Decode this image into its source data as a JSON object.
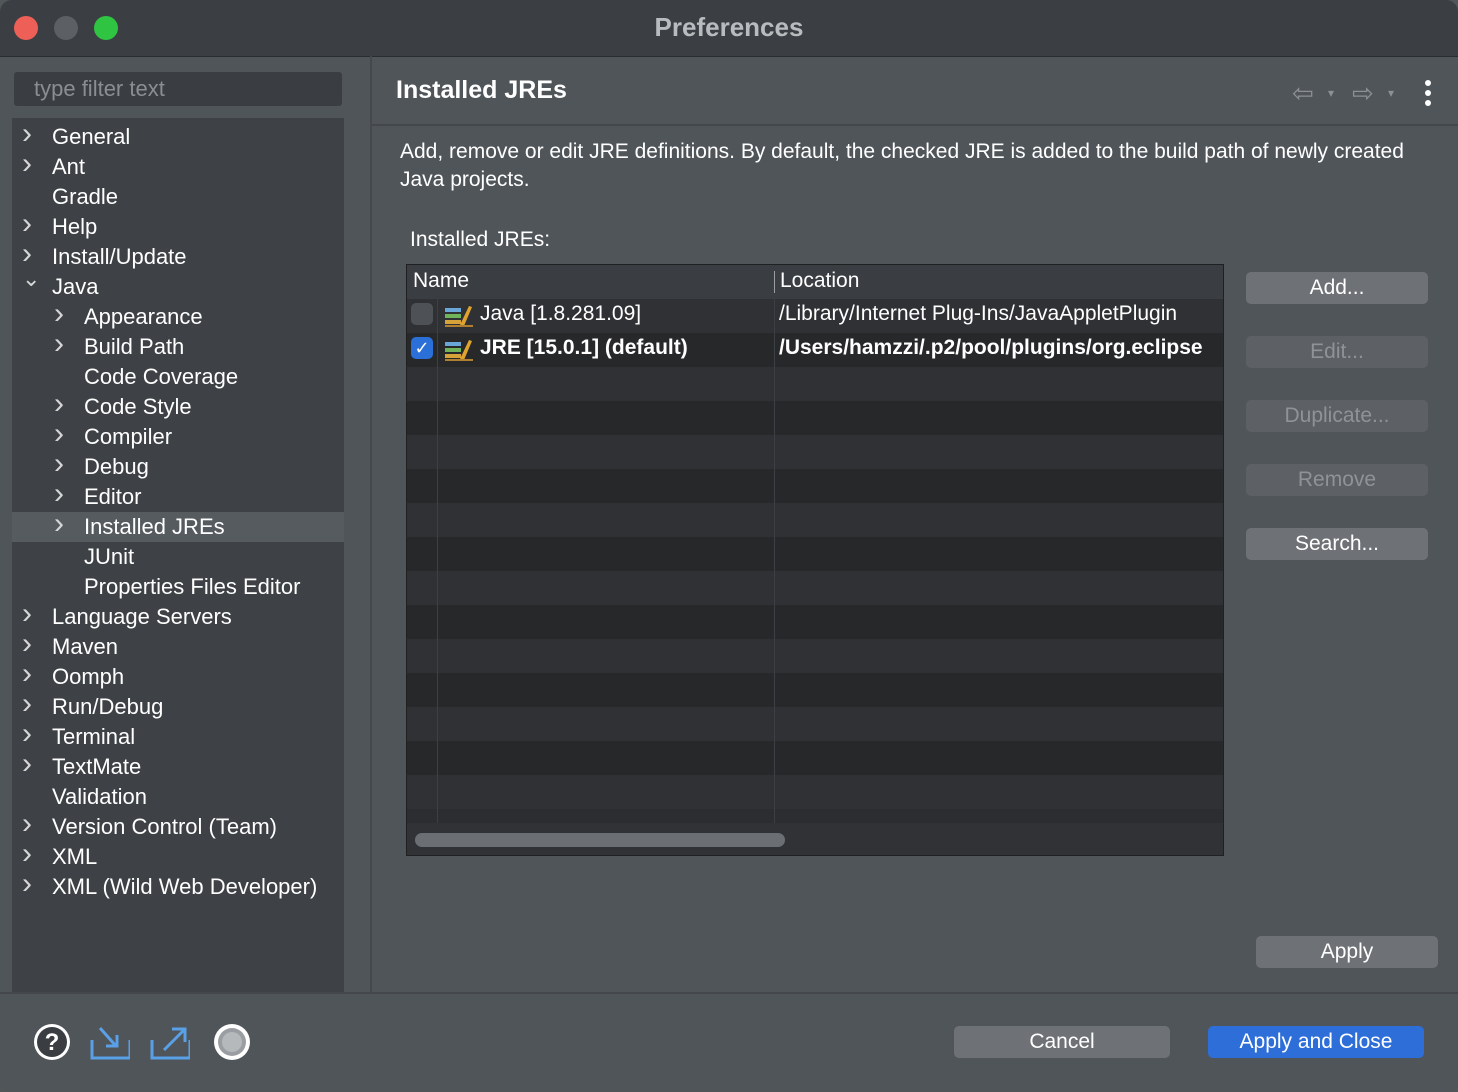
{
  "window": {
    "title": "Preferences"
  },
  "filter": {
    "placeholder": "type filter text"
  },
  "tree": [
    {
      "label": "General",
      "expandable": true,
      "level": 0
    },
    {
      "label": "Ant",
      "expandable": true,
      "level": 0
    },
    {
      "label": "Gradle",
      "expandable": false,
      "level": 0
    },
    {
      "label": "Help",
      "expandable": true,
      "level": 0
    },
    {
      "label": "Install/Update",
      "expandable": true,
      "level": 0
    },
    {
      "label": "Java",
      "expandable": true,
      "expanded": true,
      "level": 0
    },
    {
      "label": "Appearance",
      "expandable": true,
      "level": 1
    },
    {
      "label": "Build Path",
      "expandable": true,
      "level": 1
    },
    {
      "label": "Code Coverage",
      "expandable": false,
      "level": 1
    },
    {
      "label": "Code Style",
      "expandable": true,
      "level": 1
    },
    {
      "label": "Compiler",
      "expandable": true,
      "level": 1
    },
    {
      "label": "Debug",
      "expandable": true,
      "level": 1
    },
    {
      "label": "Editor",
      "expandable": true,
      "level": 1
    },
    {
      "label": "Installed JREs",
      "expandable": true,
      "level": 1,
      "selected": true
    },
    {
      "label": "JUnit",
      "expandable": false,
      "level": 1
    },
    {
      "label": "Properties Files Editor",
      "expandable": false,
      "level": 1
    },
    {
      "label": "Language Servers",
      "expandable": true,
      "level": 0
    },
    {
      "label": "Maven",
      "expandable": true,
      "level": 0
    },
    {
      "label": "Oomph",
      "expandable": true,
      "level": 0
    },
    {
      "label": "Run/Debug",
      "expandable": true,
      "level": 0
    },
    {
      "label": "Terminal",
      "expandable": true,
      "level": 0
    },
    {
      "label": "TextMate",
      "expandable": true,
      "level": 0
    },
    {
      "label": "Validation",
      "expandable": false,
      "level": 0
    },
    {
      "label": "Version Control (Team)",
      "expandable": true,
      "level": 0
    },
    {
      "label": "XML",
      "expandable": true,
      "level": 0
    },
    {
      "label": "XML (Wild Web Developer)",
      "expandable": true,
      "level": 0
    }
  ],
  "page": {
    "title": "Installed JREs",
    "description": "Add, remove or edit JRE definitions. By default, the checked JRE is added to the build path of newly created Java projects.",
    "section_label": "Installed JREs:"
  },
  "table": {
    "columns": [
      "Name",
      "Location"
    ],
    "rows": [
      {
        "name": "Java [1.8.281.09]",
        "location": "/Library/Internet Plug-Ins/JavaAppletPlugin",
        "checked": false,
        "default": false
      },
      {
        "name": "JRE [15.0.1] (default)",
        "location": "/Users/hamzzi/.p2/pool/plugins/org.eclipse",
        "checked": true,
        "default": true
      }
    ]
  },
  "buttons": {
    "add": "Add...",
    "edit": "Edit...",
    "duplicate": "Duplicate...",
    "remove": "Remove",
    "search": "Search...",
    "apply": "Apply",
    "cancel": "Cancel",
    "apply_close": "Apply and Close"
  },
  "footer_icons": [
    "help-icon",
    "import-icon",
    "export-icon",
    "record-icon"
  ],
  "colors": {
    "accent": "#2d6ed8",
    "checkbox": "#2b6fd9",
    "close": "#ee5f57",
    "maximize": "#2fc441"
  }
}
